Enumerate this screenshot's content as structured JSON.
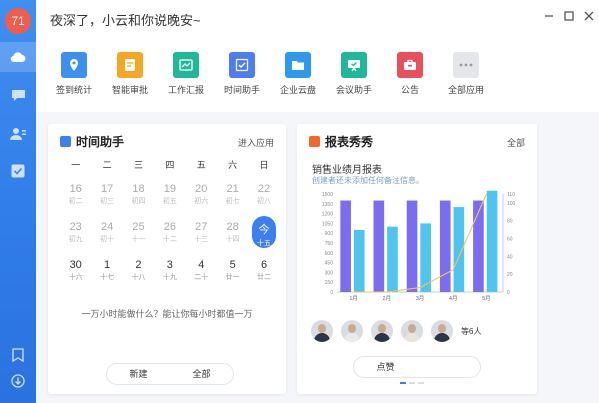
{
  "user": {
    "avatar_text": "71"
  },
  "header": {
    "greeting": "夜深了，小云和你说晚安~"
  },
  "apps": [
    {
      "label": "签到统计",
      "icon": "location-icon",
      "color": "#3d8ff2"
    },
    {
      "label": "智能审批",
      "icon": "approval-icon",
      "color": "#f5a623"
    },
    {
      "label": "工作汇报",
      "icon": "report-icon",
      "color": "#1fb89a"
    },
    {
      "label": "时间助手",
      "icon": "checkbox-icon",
      "color": "#4d7df0"
    },
    {
      "label": "企业云盘",
      "icon": "folder-icon",
      "color": "#2d9af0"
    },
    {
      "label": "会议助手",
      "icon": "meeting-icon",
      "color": "#1fb89a"
    },
    {
      "label": "公告",
      "icon": "bulletin-icon",
      "color": "#e8505b"
    },
    {
      "label": "全部应用",
      "icon": "more-icon",
      "color": "#e4e6ea"
    }
  ],
  "time_card": {
    "title": "时间助手",
    "link": "进入应用",
    "weekdays": [
      "一",
      "二",
      "三",
      "四",
      "五",
      "六",
      "日"
    ],
    "weeks": [
      [
        {
          "d": "16",
          "l": "初二"
        },
        {
          "d": "17",
          "l": "初三"
        },
        {
          "d": "18",
          "l": "初四"
        },
        {
          "d": "19",
          "l": "初五"
        },
        {
          "d": "20",
          "l": "初六"
        },
        {
          "d": "21",
          "l": "初七"
        },
        {
          "d": "22",
          "l": "初八"
        }
      ],
      [
        {
          "d": "23",
          "l": "初九"
        },
        {
          "d": "24",
          "l": "初十"
        },
        {
          "d": "25",
          "l": "十一"
        },
        {
          "d": "26",
          "l": "十二"
        },
        {
          "d": "27",
          "l": "十三"
        },
        {
          "d": "28",
          "l": "十四"
        },
        {
          "d": "今",
          "l": "十五"
        }
      ],
      [
        {
          "d": "30",
          "l": "十六"
        },
        {
          "d": "1",
          "l": "十七"
        },
        {
          "d": "2",
          "l": "十八"
        },
        {
          "d": "3",
          "l": "十九"
        },
        {
          "d": "4",
          "l": "二十"
        },
        {
          "d": "5",
          "l": "廿一"
        },
        {
          "d": "6",
          "l": "廿二"
        }
      ]
    ],
    "motto": "一万小时能做什么？能让你每小时都值一万",
    "btn_new": "新建",
    "btn_all": "全部"
  },
  "report_card": {
    "title": "报表秀秀",
    "link": "全部",
    "chart_title": "销售业绩月报表",
    "chart_sub": "创建者还未添加任何备注信息。",
    "more_people": "等6人",
    "btn_like": "点赞"
  },
  "chart_data": {
    "type": "bar",
    "categories": [
      "1月",
      "2月",
      "3月",
      "4月",
      "5月"
    ],
    "series": [
      {
        "values": [
          1400,
          1400,
          1400,
          1400,
          1400
        ],
        "color": "#7b6cf0"
      },
      {
        "values": [
          950,
          1000,
          1050,
          1300,
          1550
        ],
        "color": "#4fc4ef"
      },
      {
        "values": [
          0,
          0,
          5,
          25,
          110
        ],
        "color": "#f0c65a"
      }
    ],
    "yticks_left": [
      "1500",
      "1350",
      "1200",
      "1050",
      "900",
      "750",
      "600",
      "450",
      "300",
      "150",
      "0"
    ],
    "yticks_right": [
      "110",
      "100",
      "80",
      "60",
      "40",
      "20",
      "0"
    ],
    "ylim": [
      0,
      1500
    ],
    "ylim_right": [
      0,
      110
    ]
  }
}
